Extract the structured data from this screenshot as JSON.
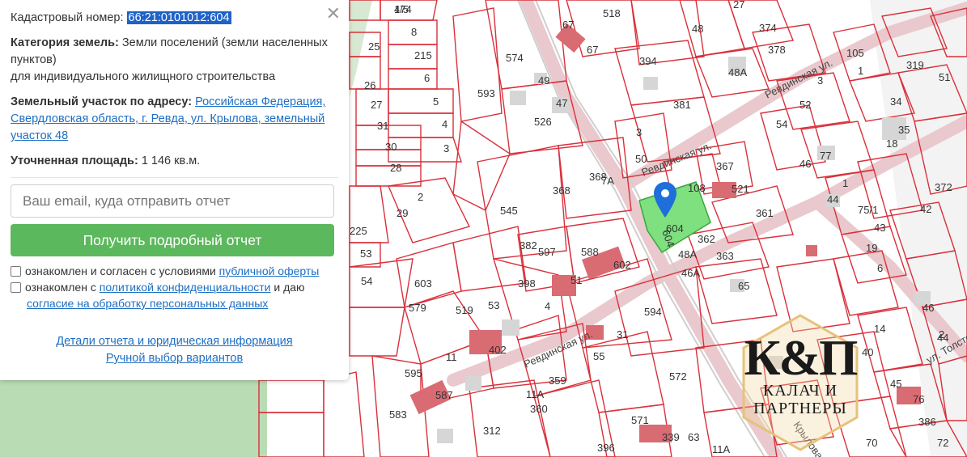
{
  "card": {
    "cadastral_label": "Кадастровый номер:",
    "cadastral_number": "66:21:0101012:604",
    "category_label": "Категория земель:",
    "category_value": "Земли поселений (земли населенных пунктов)",
    "category_use": "для индивидуального жилищного строительства",
    "address_label": "Земельный участок по адресу:",
    "address_value": "Российская Федерация, Свердловская область, г. Ревда, ул. Крылова, земельный участок 48",
    "area_label": "Уточненная площадь:",
    "area_value": "1 146 кв.м.",
    "email_placeholder": "Ваш email, куда отправить отчет",
    "report_button": "Получить подробный отчет",
    "consent1_prefix": "ознакомлен и согласен с условиями",
    "consent1_link": "публичной оферты",
    "consent2_prefix": "ознакомлен с",
    "consent2_link": "политикой конфиденциальности",
    "consent2_mid": "и даю",
    "consent2_link2": "согласие на обработку персональных данных",
    "details_link": "Детали отчета и юридическая информация",
    "manual_link": "Ручной выбор вариантов",
    "close_icon": "close-icon"
  },
  "map": {
    "parcel_color": "#d9303b",
    "selected_color": "#7ee07e",
    "streets": [
      "Ревдинская ул.",
      "Ревдинская ул.",
      "Ревдинская ул.",
      "ул. Толстого",
      "Крылова"
    ],
    "labels": [
      "174",
      "8",
      "215",
      "6",
      "5",
      "4",
      "3",
      "28",
      "30",
      "31",
      "27",
      "26",
      "25",
      "2",
      "29",
      "225",
      "53",
      "54",
      "579",
      "603",
      "519",
      "53",
      "11",
      "402",
      "595",
      "587",
      "583",
      "574",
      "593",
      "526",
      "49",
      "47",
      "545",
      "368",
      "368",
      "7А",
      "382",
      "597",
      "588",
      "602",
      "398",
      "51",
      "4",
      "594",
      "31",
      "55",
      "359",
      "360",
      "11А",
      "312",
      "396",
      "571",
      "339",
      "572",
      "518",
      "67",
      "67",
      "394",
      "48",
      "381",
      "3",
      "50",
      "108",
      "367",
      "521",
      "604",
      "362",
      "48А",
      "363",
      "46А",
      "65",
      "361",
      "3",
      "48А",
      "27",
      "374",
      "378",
      "52",
      "54",
      "77",
      "46",
      "1",
      "44",
      "75/1",
      "43",
      "19",
      "6",
      "51",
      "319",
      "34",
      "35",
      "18",
      "372",
      "42",
      "46",
      "44",
      "40",
      "45",
      "76",
      "386",
      "72",
      "70",
      "63",
      "11А",
      "105",
      "1",
      "2",
      "14",
      "4/5"
    ],
    "logo_monogram": "К&П",
    "logo_line1": "КАЛАЧ И",
    "logo_line2": "ПАРТНЕРЫ",
    "marker_icon": "map-pin-icon"
  }
}
